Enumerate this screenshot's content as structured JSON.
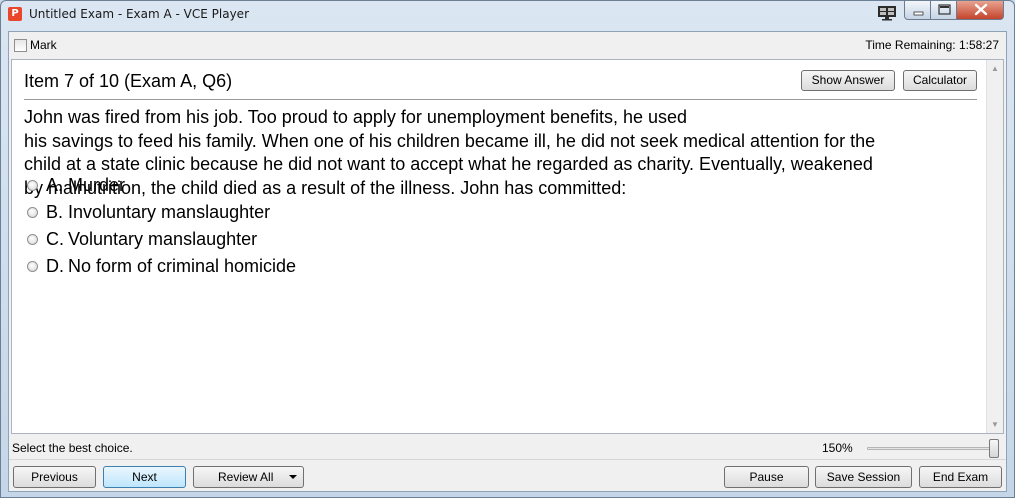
{
  "window": {
    "title": "Untitled Exam - Exam A - VCE Player",
    "app_icon_glyph": "P"
  },
  "topbar": {
    "mark_label": "Mark",
    "time_remaining": "Time Remaining: 1:58:27"
  },
  "question": {
    "header": "Item 7 of 10  (Exam A, Q6)",
    "show_answer_label": "Show Answer",
    "calculator_label": "Calculator",
    "lines": [
      "John was fired from his job. Too proud to apply for unemployment benefits, he used",
      "his savings to feed his family. When one of his children became ill, he did not seek medical attention for the",
      "child at a state clinic because he did not want to accept what he regarded as charity. Eventually, weakened",
      "by malnutrition, the child died as a result of the illness. John has committed:"
    ],
    "options": [
      {
        "letter": "A.",
        "text": "Murder"
      },
      {
        "letter": "B.",
        "text": "Involuntary manslaughter"
      },
      {
        "letter": "C.",
        "text": "Voluntary manslaughter"
      },
      {
        "letter": "D.",
        "text": "No form of criminal homicide"
      }
    ]
  },
  "status": {
    "hint": "Select the best choice.",
    "zoom": "150%",
    "zoom_level_fraction": 1.0
  },
  "buttons": {
    "previous": "Previous",
    "next": "Next",
    "review_all": "Review All",
    "pause": "Pause",
    "save_session": "Save Session",
    "end_exam": "End Exam"
  },
  "colors": {
    "accent_next_border": "#3c7fb1",
    "close_button": "#c4442b",
    "app_icon": "#e8472b"
  }
}
